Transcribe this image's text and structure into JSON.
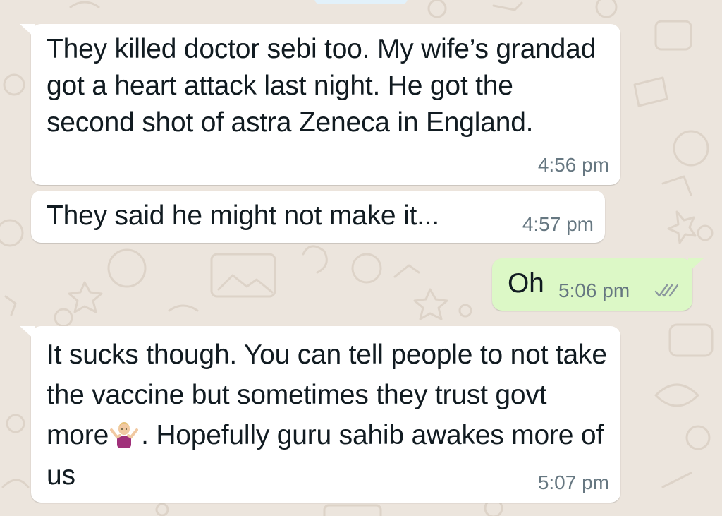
{
  "messages": [
    {
      "direction": "incoming",
      "text": "They killed doctor sebi too. My wife’s grandad got a heart attack last night. He got the second shot of astra Zeneca in England.",
      "time": "4:56 pm"
    },
    {
      "direction": "incoming",
      "text": "They said he might not make it...",
      "time": "4:57 pm"
    },
    {
      "direction": "outgoing",
      "text": "Oh",
      "time": "5:06 pm",
      "status_icon": "double-check-icon"
    },
    {
      "direction": "incoming",
      "text_before_emoji": "It sucks though. You can tell people to not take the vaccine but sometimes they trust govt more",
      "emoji": "person-shrugging-emoji",
      "text_after_emoji": ". Hopefully guru sahib awakes more of us",
      "time": "5:07 pm"
    }
  ],
  "colors": {
    "incoming_bubble": "#ffffff",
    "outgoing_bubble": "#dcf8c6",
    "background": "#ece5dd",
    "timestamp": "#667781",
    "read_ticks": "#8b979e"
  }
}
